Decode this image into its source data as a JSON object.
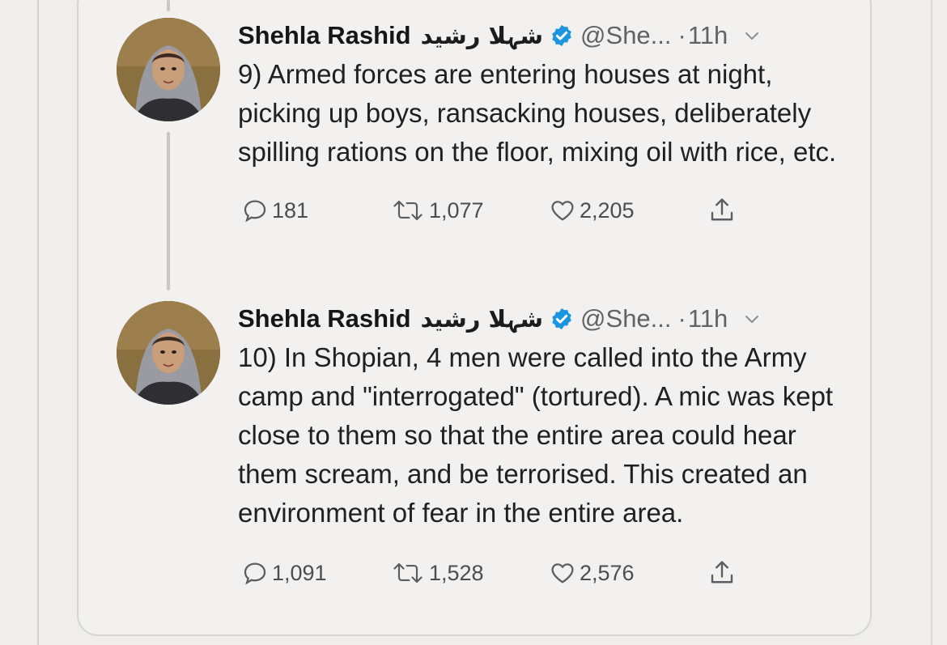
{
  "tweets": [
    {
      "name": "Shehla Rashid",
      "name_urdu": "شہلا رشید",
      "handle": "@She...",
      "separator": "·",
      "time": "11h",
      "text": "9) Armed forces are entering houses at night, picking up boys, ransacking houses, deliberately spilling rations on the floor, mixing oil with rice, etc.",
      "replies": "181",
      "retweets": "1,077",
      "likes": "2,205"
    },
    {
      "name": "Shehla Rashid",
      "name_urdu": "شہلا رشید",
      "handle": "@She...",
      "separator": "·",
      "time": "11h",
      "text": "10) In Shopian, 4 men were called into the Army camp and \"interrogated\" (tortured). A mic was kept close to them so that the entire area could hear them scream, and be terrorised. This created an environment of fear in the entire area.",
      "replies": "1,091",
      "retweets": "1,528",
      "likes": "2,576"
    }
  ],
  "icons": {
    "reply": "reply-icon",
    "retweet": "retweet-icon",
    "like": "heart-icon",
    "share": "share-icon",
    "verified": "verified-badge-icon",
    "more": "chevron-down-icon"
  },
  "colors": {
    "background": "#efeeec",
    "verified": "#1b95e0",
    "muted": "#5f6266"
  }
}
